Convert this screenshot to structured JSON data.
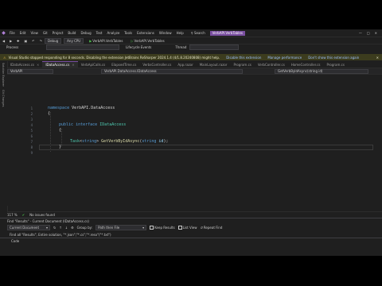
{
  "menubar": {
    "items": [
      "File",
      "Edit",
      "View",
      "Git",
      "Project",
      "Build",
      "Debug",
      "Test",
      "Analyze",
      "Tools",
      "Extensions",
      "Window",
      "Help"
    ],
    "search": "Search",
    "solution": "VerbAPI.VerbTables"
  },
  "toolbar": {
    "config": "Debug",
    "platform": "Any CPU",
    "startup1": "VerbAPI.VerbTables",
    "startup2": "VerbAPI.VerbTables"
  },
  "procbar": {
    "process": "Process",
    "lifecycle": "Lifecycle Events",
    "thread": "Thread"
  },
  "infobar": {
    "message": "Visual Studio stopped responding for 8 seconds. Disabling the extension JetBrains ReSharper 2024.1.4 (4/1.8.20240808) might help.",
    "disable": "Disable this extension",
    "manage": "Manage performance",
    "never": "Don't show this extension again"
  },
  "tabs": [
    "IDataAccess.cs",
    "IDataAccess.cs",
    "VerbApiCalls.cs",
    "ElapsedTime.cs",
    "VerbsController.cs",
    "App.razor",
    "MainLayout.razor",
    "Program.cs",
    "VerbController.cs",
    "HomeController.cs",
    "Program.cs"
  ],
  "sidebar": [
    "Solution Explorer",
    "Git Changes"
  ],
  "navbar": {
    "project": "VerbAPI",
    "scope": "VerbAPI.DataAccess.IDataAccess",
    "member": "GetVerbByIdAsync(string id)"
  },
  "editor": {
    "line_numbers": [
      "1",
      "2",
      "3",
      "4",
      "5",
      "6",
      "7",
      "8",
      "9"
    ],
    "l1_kw": "namespace",
    "l1_ns": "VerbAPI.DataAccess",
    "l2": "{",
    "l4_kw1": "public",
    "l4_kw2": "interface",
    "l4_type": "IDataAccess",
    "l5": "{",
    "l7_task": "Task",
    "l7_lt": "<",
    "l7_str": "string",
    "l7_gt": ">",
    "l7_method": "GetVerbByIdAsync",
    "l7_lp": "(",
    "l7_ptype": "string",
    "l7_param": "id",
    "l7_end": ");",
    "l8": "}"
  },
  "status": {
    "zoom": "117 %",
    "issues": "No issues found"
  },
  "panel": {
    "header": "Find \"Results\" - Current Document (IDataAccess.cs)",
    "scope": "Current Document",
    "group_by_label": "Group by:",
    "group_by": "Path then File",
    "keep_results": "Keep Results",
    "list_view": "List View",
    "repeat_find": "Repeat Find",
    "find_line": "Find all \"Results\", Entire solution, \"*.json\";\"*.cs\";\"*.resx\"(\"*.txt\")",
    "column": "Code"
  }
}
